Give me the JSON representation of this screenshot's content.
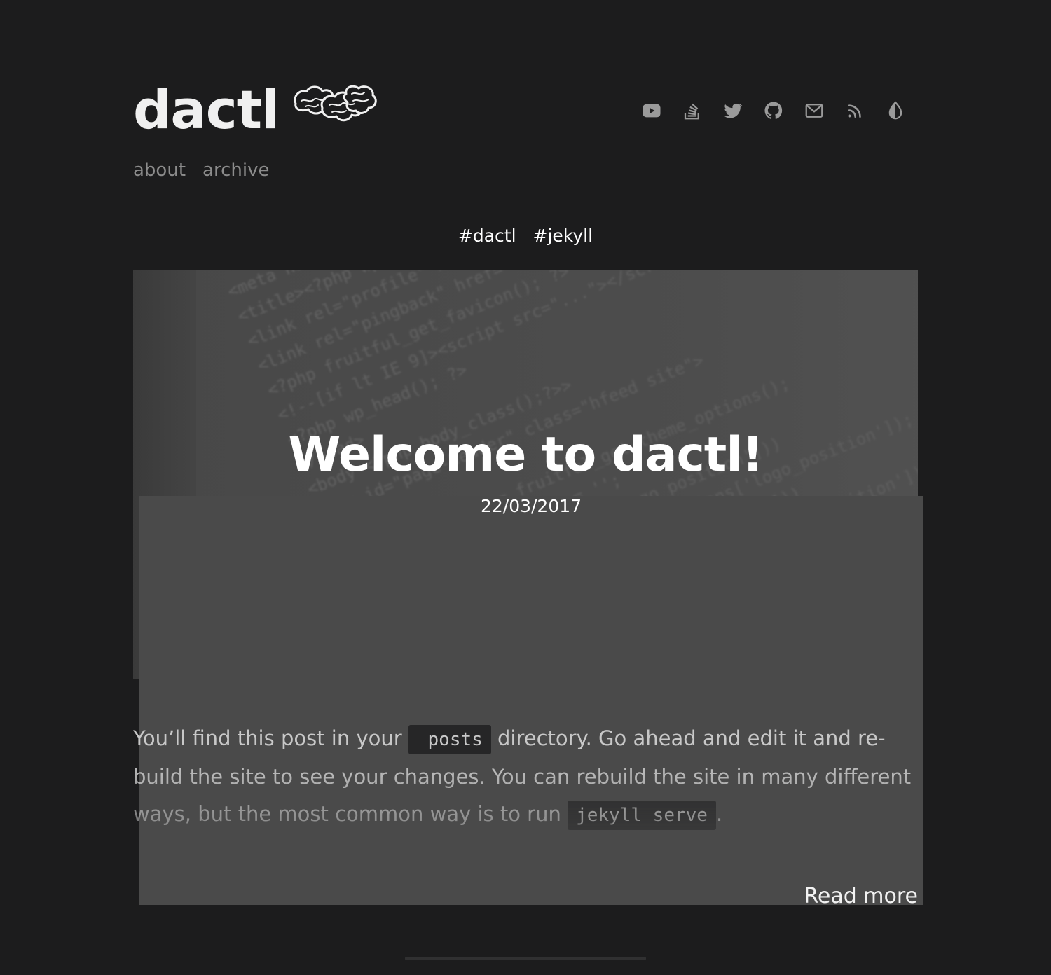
{
  "header": {
    "site_name": "dactl",
    "nav": [
      {
        "label": "about"
      },
      {
        "label": "archive"
      }
    ],
    "social_icons": [
      "youtube-icon",
      "stackoverflow-icon",
      "twitter-icon",
      "github-icon",
      "mail-icon",
      "rss-icon",
      "theme-toggle-icon"
    ]
  },
  "post": {
    "title": "Welcome to dactl!",
    "date": "22/03/2017",
    "tags": [
      "#dactl",
      "#jekyll"
    ],
    "excerpt": {
      "part1": "You’ll find this post in your ",
      "code1": "_posts",
      "part2": " directory. Go ahead and edit it and re-build the site to see your changes. You can rebuild the site in many different ways, but the most common way is to run ",
      "code2": "jekyll serve",
      "part3": "."
    },
    "read_more": "Read more"
  },
  "colors": {
    "background": "#1c1c1d",
    "text": "#c8c8c8",
    "nav": "#8c8c8c",
    "icon": "#9a9a9a"
  }
}
